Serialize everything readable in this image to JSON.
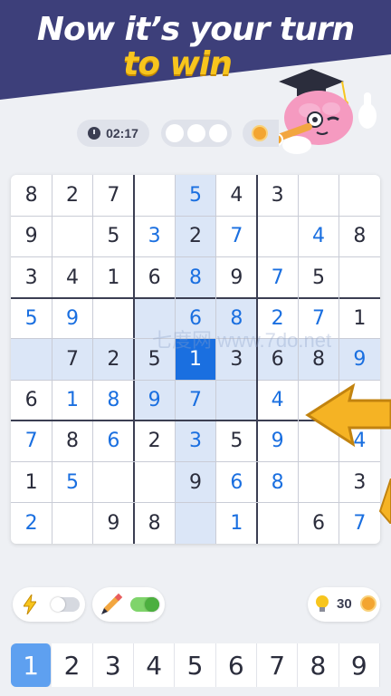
{
  "headline": {
    "line1": "Now it’s your turn",
    "line2": "to win"
  },
  "status": {
    "timer": "02:17",
    "mistakes_max": 3
  },
  "board": {
    "rows": [
      [
        {
          "v": "8"
        },
        {
          "v": "2"
        },
        {
          "v": "7"
        },
        {
          "v": ""
        },
        {
          "v": "5",
          "u": true
        },
        {
          "v": "4"
        },
        {
          "v": "3"
        },
        {
          "v": ""
        },
        {
          "v": ""
        }
      ],
      [
        {
          "v": "9"
        },
        {
          "v": ""
        },
        {
          "v": "5"
        },
        {
          "v": "3",
          "u": true
        },
        {
          "v": "2"
        },
        {
          "v": "7",
          "u": true
        },
        {
          "v": ""
        },
        {
          "v": "4",
          "u": true
        },
        {
          "v": "8"
        }
      ],
      [
        {
          "v": "3"
        },
        {
          "v": "4"
        },
        {
          "v": "1"
        },
        {
          "v": "6"
        },
        {
          "v": "8",
          "u": true
        },
        {
          "v": "9"
        },
        {
          "v": "7",
          "u": true
        },
        {
          "v": "5"
        },
        {
          "v": ""
        }
      ],
      [
        {
          "v": "5",
          "u": true
        },
        {
          "v": "9",
          "u": true
        },
        {
          "v": ""
        },
        {
          "v": ""
        },
        {
          "v": "6",
          "u": true
        },
        {
          "v": "8",
          "u": true
        },
        {
          "v": "2",
          "u": true
        },
        {
          "v": "7",
          "u": true
        },
        {
          "v": "1"
        }
      ],
      [
        {
          "v": ""
        },
        {
          "v": "7"
        },
        {
          "v": "2"
        },
        {
          "v": "5"
        },
        {
          "v": "1",
          "u": true
        },
        {
          "v": "3"
        },
        {
          "v": "6"
        },
        {
          "v": "8"
        },
        {
          "v": "9",
          "u": true
        }
      ],
      [
        {
          "v": "6"
        },
        {
          "v": "1",
          "u": true
        },
        {
          "v": "8",
          "u": true
        },
        {
          "v": "9",
          "u": true
        },
        {
          "v": "7",
          "u": true
        },
        {
          "v": ""
        },
        {
          "v": "4",
          "u": true
        },
        {
          "v": ""
        },
        {
          "v": ""
        }
      ],
      [
        {
          "v": "7",
          "u": true
        },
        {
          "v": "8"
        },
        {
          "v": "6",
          "u": true
        },
        {
          "v": "2"
        },
        {
          "v": "3",
          "u": true
        },
        {
          "v": "5"
        },
        {
          "v": "9",
          "u": true
        },
        {
          "v": ""
        },
        {
          "v": "4",
          "u": true
        }
      ],
      [
        {
          "v": "1"
        },
        {
          "v": "5",
          "u": true
        },
        {
          "v": ""
        },
        {
          "v": ""
        },
        {
          "v": "9"
        },
        {
          "v": "6",
          "u": true
        },
        {
          "v": "8",
          "u": true
        },
        {
          "v": ""
        },
        {
          "v": "3"
        }
      ],
      [
        {
          "v": "2",
          "u": true
        },
        {
          "v": ""
        },
        {
          "v": "9"
        },
        {
          "v": "8"
        },
        {
          "v": ""
        },
        {
          "v": "1",
          "u": true
        },
        {
          "v": ""
        },
        {
          "v": "6"
        },
        {
          "v": "7",
          "u": true
        }
      ]
    ],
    "selected": {
      "row": 4,
      "col": 4
    }
  },
  "watermark": "七度网 www.7do.net",
  "tools": {
    "fast_mode_icon": "lightning-icon",
    "fast_mode_on": false,
    "pencil_icon": "pencil-icon",
    "pencil_on": true,
    "hint_icon": "lightbulb-icon",
    "hint_count": "30",
    "hint_coin_icon": "coin-icon"
  },
  "numpad": {
    "keys": [
      "1",
      "2",
      "3",
      "4",
      "5",
      "6",
      "7",
      "8",
      "9"
    ],
    "active": "1"
  },
  "colors": {
    "banner": "#3d3f7a",
    "accent": "#1a6fe0",
    "highlight": "#dbe6f7",
    "yellow": "#f7c51e",
    "arrow": "#f5b324"
  }
}
